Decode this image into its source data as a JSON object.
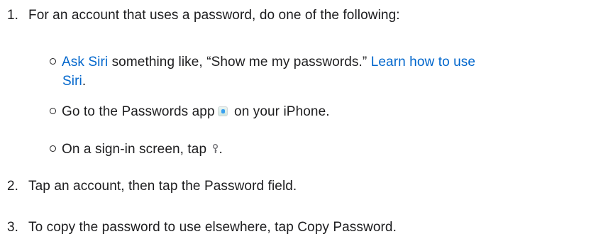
{
  "steps": [
    {
      "number": "1.",
      "text": "For an account that uses a password, do one of the following:",
      "substeps": [
        {
          "link1": "Ask Siri",
          "text1": " something like, “Show me my passwords.” ",
          "link2_part1": "Learn how to use",
          "link2_part2": "Siri",
          "text2": "."
        },
        {
          "text_before": "Go to the Passwords app",
          "icon": "passwords-app-icon",
          "text_after": " on your iPhone."
        },
        {
          "text_before": "On a sign-in screen, tap ",
          "icon": "key-icon",
          "text_after": "."
        }
      ]
    },
    {
      "number": "2.",
      "text": "Tap an account, then tap the Password field."
    },
    {
      "number": "3.",
      "text": "To copy the password to use elsewhere, tap Copy Password."
    }
  ],
  "colors": {
    "text": "#1d1d1f",
    "link": "#0066cc"
  }
}
